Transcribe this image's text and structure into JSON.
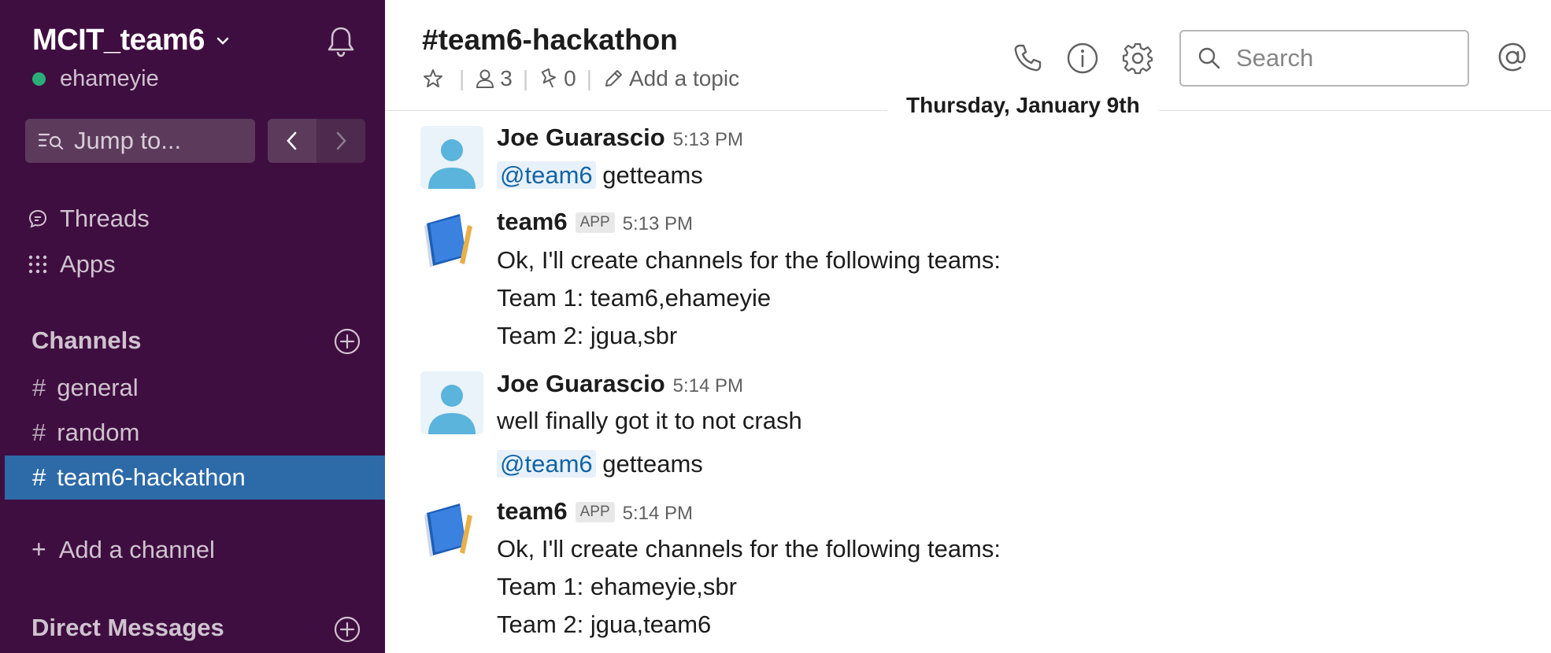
{
  "workspace": {
    "name": "MCIT_team6",
    "user": "ehameyie"
  },
  "sidebar": {
    "jump_label": "Jump to...",
    "items": [
      {
        "label": "Threads",
        "icon": "threads-icon"
      },
      {
        "label": "Apps",
        "icon": "apps-icon"
      }
    ],
    "channels_header": "Channels",
    "channels": [
      {
        "label": "general"
      },
      {
        "label": "random"
      },
      {
        "label": "team6-hackathon"
      }
    ],
    "add_channel_label": "Add a channel",
    "dm_header": "Direct Messages",
    "active_color": "#2d6aa8",
    "bg_color": "#3f0e40"
  },
  "header": {
    "channel_title": "#team6-hackathon",
    "members_count": "3",
    "pins_count": "0",
    "topic_placeholder": "Add a topic",
    "search_placeholder": "Search"
  },
  "messages": {
    "date_divider": "Thursday, January 9th",
    "m1": {
      "author": "Joe Guarascio",
      "time": "5:13 PM",
      "mention": "@team6",
      "text": "getteams"
    },
    "m2": {
      "author": "team6",
      "badge": "APP",
      "time": "5:13 PM",
      "line1": "Ok, I'll create channels for the following teams:",
      "line2": "Team 1: team6,ehameyie",
      "line3": "Team 2: jgua,sbr"
    },
    "m3": {
      "author": "Joe Guarascio",
      "time": "5:14 PM",
      "text1": "well finally got it to not crash",
      "mention": "@team6",
      "text2": "getteams"
    },
    "m4": {
      "author": "team6",
      "badge": "APP",
      "time": "5:14 PM",
      "line1": "Ok, I'll create channels for the following teams:",
      "line2": "Team 1: ehameyie,sbr",
      "line3": "Team 2: jgua,team6"
    }
  }
}
